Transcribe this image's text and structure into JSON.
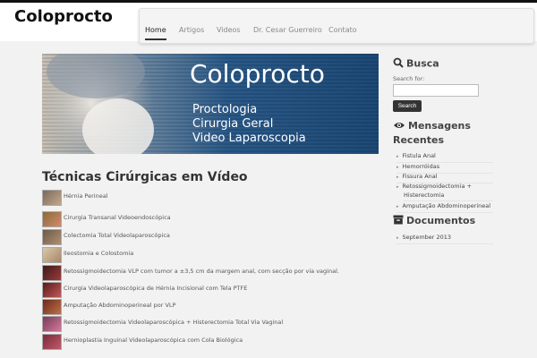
{
  "header": {
    "logo": "Coloprocto",
    "nav": [
      {
        "label": "Home",
        "active": true
      },
      {
        "label": "Artigos",
        "active": false
      },
      {
        "label": "Videos",
        "active": false
      },
      {
        "label": "Dr. Cesar Guerreiro",
        "active": false
      },
      {
        "label": "Contato",
        "active": false
      }
    ]
  },
  "banner": {
    "title": "Coloprocto",
    "lines": [
      "Proctologia",
      "Cirurgia Geral",
      "Video Laparoscopia"
    ]
  },
  "main": {
    "page_title": "Técnicas Cirúrgicas em Vídeo",
    "videos": [
      {
        "label": "Hérnia Perineal"
      },
      {
        "label": "Cirurgia Transanal Videoendoscópica"
      },
      {
        "label": " Colectomia Total Videolaparoscópica"
      },
      {
        "label": "Ileostomia e Colostomia"
      },
      {
        "label": "Retossigmoidectomia VLP com tumor a ±3,5 cm da margem anal, com secção por via vaginal."
      },
      {
        "label": "Cirurgia Videolaparoscópica de Hérnia Incisional com Tela PTFE"
      },
      {
        "label": "Amputação Abdominoperineal por VLP"
      },
      {
        "label": "Retossigmoidectomia Videolaparoscópica + Histerectomia Total Via Vaginal"
      },
      {
        "label": "Hernioplastia Inguinal Videolaparoscópica com Cola Biológica"
      }
    ]
  },
  "sidebar": {
    "search": {
      "title": "Busca",
      "label": "Search for:",
      "value": "",
      "button": "Search",
      "icon": "search-icon"
    },
    "recent": {
      "title_line1": "Mensagens",
      "title_line2": "Recentes",
      "icon": "eye-icon",
      "items": [
        {
          "label": "Fistula Anal"
        },
        {
          "label": "Hemorróidas"
        },
        {
          "label": "Fissura Anal"
        },
        {
          "label": "Retossigmoidectomia +"
        },
        {
          "label": "Histerectomia"
        },
        {
          "label": "Amputação Abdominoperineal"
        }
      ]
    },
    "documents": {
      "title": "Documentos",
      "icon": "archive-icon",
      "items": [
        {
          "label": "September 2013"
        }
      ]
    }
  },
  "colors": {
    "accent": "#333333",
    "background": "#f2f2f2",
    "banner_blue": "#2a5a8a"
  }
}
